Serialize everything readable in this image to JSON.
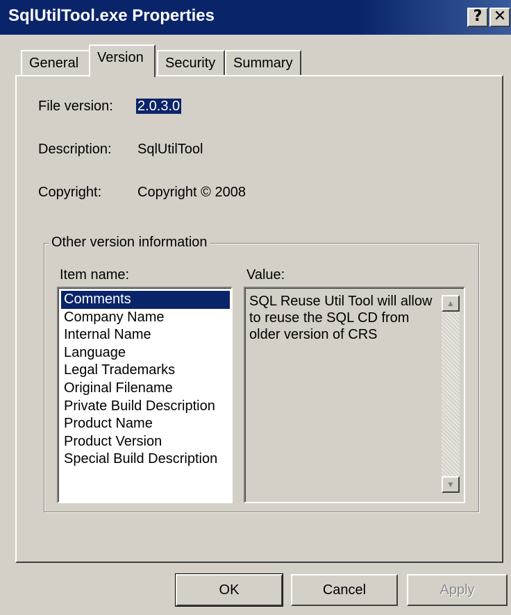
{
  "window": {
    "title": "SqlUtilTool.exe Properties",
    "help_glyph": "?",
    "close_glyph": "✕"
  },
  "tabs": [
    {
      "label": "General"
    },
    {
      "label": "Version"
    },
    {
      "label": "Security"
    },
    {
      "label": "Summary"
    }
  ],
  "active_tab": "Version",
  "fields": {
    "file_version_label": "File version:",
    "file_version_value": "2.0.3.0",
    "description_label": "Description:",
    "description_value": "SqlUtilTool",
    "copyright_label": "Copyright:",
    "copyright_value": "Copyright © 2008"
  },
  "other_info": {
    "group_label": "Other version information",
    "item_name_label": "Item name:",
    "value_label": "Value:",
    "items": [
      "Comments",
      "Company Name",
      "Internal Name",
      "Language",
      "Legal Trademarks",
      "Original Filename",
      "Private Build Description",
      "Product Name",
      "Product Version",
      "Special Build Description"
    ],
    "selected_item": "Comments",
    "value_text": "SQL Reuse Util Tool will allow to reuse the SQL CD from older version of CRS"
  },
  "buttons": {
    "ok": "OK",
    "cancel": "Cancel",
    "apply": "Apply"
  },
  "colors": {
    "titlebar": "#0a246a",
    "face": "#d4d0c8",
    "selection": "#0a246a"
  }
}
